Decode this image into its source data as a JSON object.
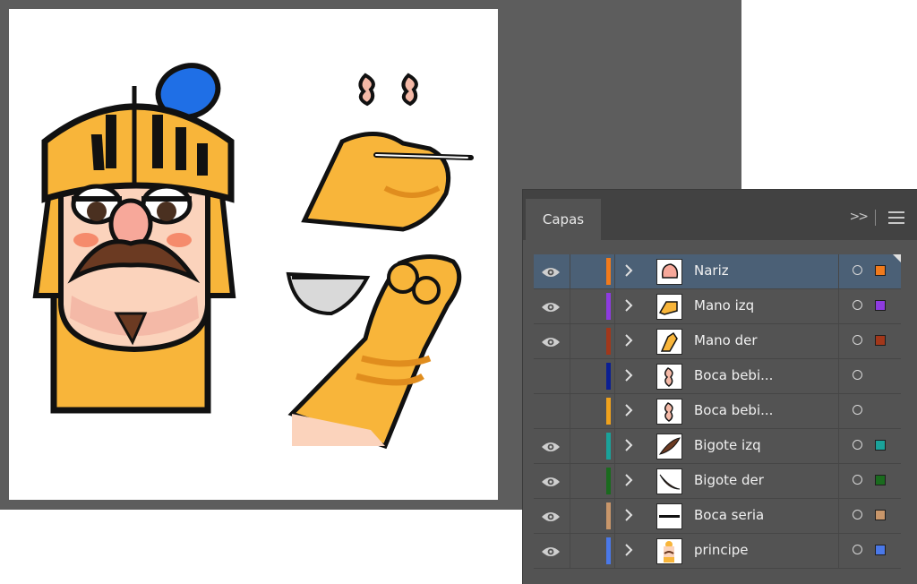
{
  "panel": {
    "tab_label": "Capas",
    "collapse_icon": "double-chevron-right-icon",
    "menu_icon": "hamburger-menu-icon"
  },
  "layers": [
    {
      "name": "Nariz",
      "color": "#f07a1c",
      "visible": true,
      "selected": true,
      "swatch": "#f07a1c"
    },
    {
      "name": "Mano izq",
      "color": "#8e3be0",
      "visible": true,
      "selected": false,
      "swatch": "#8e3be0"
    },
    {
      "name": "Mano der",
      "color": "#a2371a",
      "visible": true,
      "selected": false,
      "swatch": "#a2371a"
    },
    {
      "name": "Boca bebi...",
      "color": "#0b1f93",
      "visible": false,
      "selected": false,
      "swatch": null
    },
    {
      "name": "Boca bebi...",
      "color": "#f0a21c",
      "visible": false,
      "selected": false,
      "swatch": null
    },
    {
      "name": "Bigote izq",
      "color": "#1aa29a",
      "visible": true,
      "selected": false,
      "swatch": "#1aa29a"
    },
    {
      "name": "Bigote der",
      "color": "#1a6b1e",
      "visible": true,
      "selected": false,
      "swatch": "#1a6b1e"
    },
    {
      "name": "Boca seria",
      "color": "#c8966a",
      "visible": true,
      "selected": false,
      "swatch": "#c8966a"
    },
    {
      "name": "principe",
      "color": "#4a78e8",
      "visible": true,
      "selected": false,
      "swatch": "#4a78e8"
    }
  ]
}
